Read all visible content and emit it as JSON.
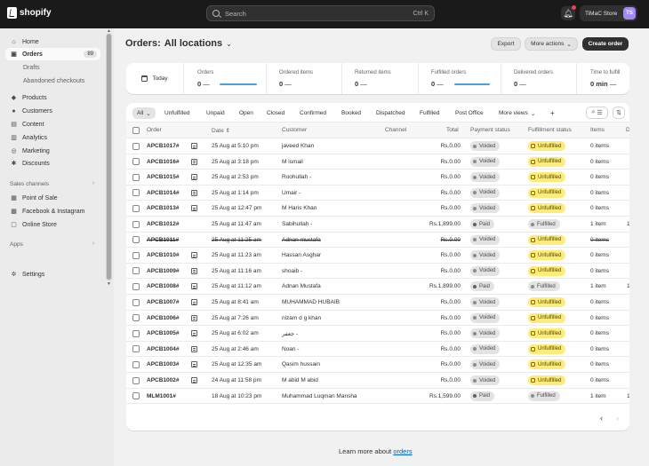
{
  "topbar": {
    "logo": "shopify",
    "search_placeholder": "Search",
    "shortcut": "Ctrl K",
    "store_name": "TiMaC Store",
    "avatar_initials": "TS"
  },
  "sidebar": {
    "items": [
      {
        "label": "Home",
        "icon": "home-icon"
      },
      {
        "label": "Orders",
        "icon": "orders-icon",
        "badge": "89"
      },
      {
        "label": "Drafts"
      },
      {
        "label": "Abandoned checkouts"
      },
      {
        "label": "Products",
        "icon": "tag-icon"
      },
      {
        "label": "Customers",
        "icon": "person-icon"
      },
      {
        "label": "Content",
        "icon": "content-icon"
      },
      {
        "label": "Analytics",
        "icon": "chart-icon"
      },
      {
        "label": "Marketing",
        "icon": "target-icon"
      },
      {
        "label": "Discounts",
        "icon": "discount-icon"
      }
    ],
    "sales_channels_label": "Sales channels",
    "channels": [
      {
        "label": "Point of Sale",
        "icon": "pos-icon"
      },
      {
        "label": "Facebook & Instagram",
        "icon": "meta-icon"
      },
      {
        "label": "Online Store",
        "icon": "store-icon"
      }
    ],
    "apps_label": "Apps",
    "settings_label": "Settings"
  },
  "main": {
    "title": "Orders:",
    "location": "All locations",
    "export_label": "Export",
    "more_actions_label": "More actions",
    "create_label": "Create order",
    "today_label": "Today",
    "stats": [
      {
        "label": "Orders",
        "value": "0",
        "dash": "—"
      },
      {
        "label": "Ordered items",
        "value": "0",
        "dash": "—"
      },
      {
        "label": "Returned items",
        "value": "0",
        "dash": "—"
      },
      {
        "label": "Fulfilled orders",
        "value": "0",
        "dash": "—"
      },
      {
        "label": "Delivered orders",
        "value": "0",
        "dash": "—"
      },
      {
        "label": "Time to fulfill",
        "value": "0 min",
        "dash": "—"
      }
    ],
    "filter_tabs": [
      "All",
      "Unfulfilled",
      "Unpaid",
      "Open",
      "Closed",
      "Confirmed",
      "Booked",
      "Dispatched",
      "Fulfilled",
      "Post Office",
      "More views",
      "+"
    ],
    "columns": [
      "Order",
      "Date",
      "Customer",
      "Channel",
      "Total",
      "Payment status",
      "Fulfillment status",
      "Items",
      "D"
    ],
    "rows": [
      {
        "order": "APCB1017#",
        "note": true,
        "date": "25 Aug at 5:10 pm",
        "customer": "javeed Khan",
        "total": "Rs.0.00",
        "payment": "Voided",
        "fulfillment": "Unfulfilled",
        "items": "0 items",
        "extra": ""
      },
      {
        "order": "APCB1016#",
        "note": true,
        "date": "25 Aug at 3:18 pm",
        "customer": "M ismail",
        "total": "Rs.0.00",
        "payment": "Voided",
        "fulfillment": "Unfulfilled",
        "items": "0 items",
        "extra": ""
      },
      {
        "order": "APCB1015#",
        "note": true,
        "date": "25 Aug at 2:53 pm",
        "customer": "Roohullah -",
        "total": "Rs.0.00",
        "payment": "Voided",
        "fulfillment": "Unfulfilled",
        "items": "0 items",
        "extra": ""
      },
      {
        "order": "APCB1014#",
        "note": true,
        "date": "25 Aug at 1:14 pm",
        "customer": "Umair -",
        "total": "Rs.0.00",
        "payment": "Voided",
        "fulfillment": "Unfulfilled",
        "items": "0 items",
        "extra": ""
      },
      {
        "order": "APCB1013#",
        "note": true,
        "date": "25 Aug at 12:47 pm",
        "customer": "M Haris Khan",
        "total": "Rs.0.00",
        "payment": "Voided",
        "fulfillment": "Unfulfilled",
        "items": "0 items",
        "extra": ""
      },
      {
        "order": "APCB1012#",
        "note": false,
        "date": "25 Aug at 11:47 am",
        "customer": "Sabihullah -",
        "total": "Rs.1,899.00",
        "payment": "Paid",
        "fulfillment": "Fulfilled",
        "items": "1 item",
        "extra": "1"
      },
      {
        "order": "APCB1011#",
        "note": false,
        "strike": true,
        "date": "25 Aug at 11:25 am",
        "customer": "Adnan mustafa",
        "total": "Rs.0.00",
        "payment": "Voided",
        "fulfillment": "Unfulfilled",
        "items": "0 items",
        "extra": ""
      },
      {
        "order": "APCB1010#",
        "note": true,
        "date": "25 Aug at 11:23 am",
        "customer": "Hassan Asghar",
        "total": "Rs.0.00",
        "payment": "Voided",
        "fulfillment": "Unfulfilled",
        "items": "0 items",
        "extra": ""
      },
      {
        "order": "APCB1009#",
        "note": true,
        "date": "25 Aug at 11:16 am",
        "customer": "shoaib -",
        "total": "Rs.0.00",
        "payment": "Voided",
        "fulfillment": "Unfulfilled",
        "items": "0 items",
        "extra": ""
      },
      {
        "order": "APCB1008#",
        "note": true,
        "date": "25 Aug at 11:12 am",
        "customer": "Adnan Mustafa",
        "total": "Rs.1,899.00",
        "payment": "Paid",
        "fulfillment": "Fulfilled",
        "items": "1 item",
        "extra": "1"
      },
      {
        "order": "APCB1007#",
        "note": true,
        "date": "25 Aug at 8:41 am",
        "customer": "MUHAMMAD HUBAIB",
        "total": "Rs.0.00",
        "payment": "Voided",
        "fulfillment": "Unfulfilled",
        "items": "0 items",
        "extra": ""
      },
      {
        "order": "APCB1006#",
        "note": true,
        "date": "25 Aug at 7:26 am",
        "customer": "nizam d g khan",
        "total": "Rs.0.00",
        "payment": "Voided",
        "fulfillment": "Unfulfilled",
        "items": "0 items",
        "extra": ""
      },
      {
        "order": "APCB1005#",
        "note": true,
        "date": "25 Aug at 6:02 am",
        "customer": "جعفر -",
        "total": "Rs.0.00",
        "payment": "Voided",
        "fulfillment": "Unfulfilled",
        "items": "0 items",
        "extra": ""
      },
      {
        "order": "APCB1004#",
        "note": true,
        "date": "25 Aug at 2:46 am",
        "customer": "Noan -",
        "total": "Rs.0.00",
        "payment": "Voided",
        "fulfillment": "Unfulfilled",
        "items": "0 items",
        "extra": ""
      },
      {
        "order": "APCB1003#",
        "note": true,
        "date": "25 Aug at 12:35 am",
        "customer": "Qasim hussain",
        "total": "Rs.0.00",
        "payment": "Voided",
        "fulfillment": "Unfulfilled",
        "items": "0 items",
        "extra": ""
      },
      {
        "order": "APCB1002#",
        "note": true,
        "date": "24 Aug at 11:58 pm",
        "customer": "M abid M abid",
        "total": "Rs.0.00",
        "payment": "Voided",
        "fulfillment": "Unfulfilled",
        "items": "0 items",
        "extra": ""
      },
      {
        "order": "MLM1001#",
        "note": false,
        "date": "18 Aug at 10:23 pm",
        "customer": "Muhammad Luqman Mansha",
        "total": "Rs.1,599.00",
        "payment": "Paid",
        "fulfillment": "Fulfilled",
        "items": "1 item",
        "extra": "1"
      }
    ],
    "pager_prev": "‹",
    "pager_next": "›",
    "footer_text": "Learn more about",
    "footer_link": "orders"
  },
  "colors": {
    "topbar": "#1a1a1a",
    "primary_button": "#303030",
    "unfulfilled_badge": "#ffeb78",
    "link": "#005bd3",
    "chart_line": "#4d9fdb"
  }
}
